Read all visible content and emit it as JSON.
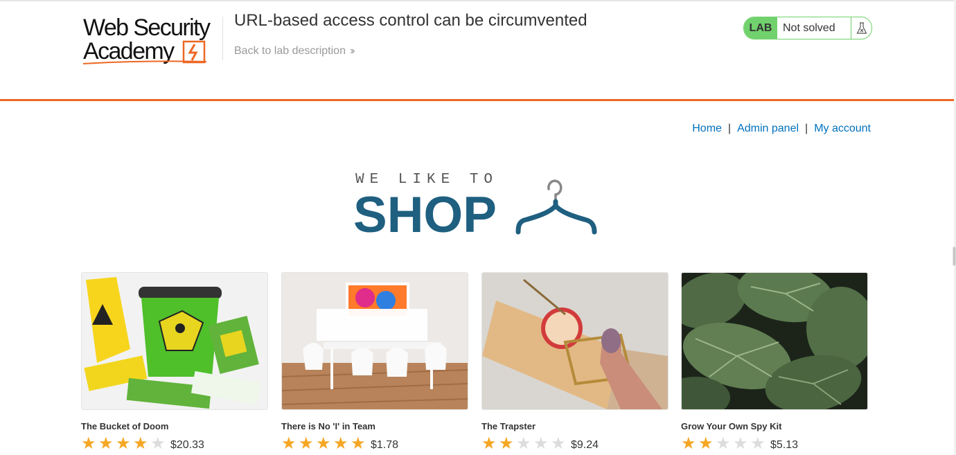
{
  "header": {
    "logo": {
      "line1": "Web Security",
      "line2": "Academy"
    },
    "lab_title": "URL-based access control can be circumvented",
    "back_link": "Back to lab description",
    "status": {
      "badge": "LAB",
      "state": "Not solved",
      "icon": "flask-icon"
    }
  },
  "nav": {
    "home": "Home",
    "admin_panel": "Admin panel",
    "my_account": "My account",
    "separator": "|"
  },
  "banner": {
    "tagline": "WE LIKE TO",
    "word": "SHOP",
    "icon": "hanger-icon"
  },
  "colors": {
    "accent_orange": "#ee6723",
    "lab_green": "#70d16d",
    "link_blue": "#0071bc",
    "shop_blue": "#1f5f80",
    "star": "#f5a623"
  },
  "products": [
    {
      "name": "The Bucket of Doom",
      "rating": 4,
      "max_rating": 5,
      "price": "$20.33"
    },
    {
      "name": "There is No 'I' in Team",
      "rating": 5,
      "max_rating": 5,
      "price": "$1.78"
    },
    {
      "name": "The Trapster",
      "rating": 2,
      "max_rating": 5,
      "price": "$9.24"
    },
    {
      "name": "Grow Your Own Spy Kit",
      "rating": 2,
      "max_rating": 5,
      "price": "$5.13"
    }
  ]
}
